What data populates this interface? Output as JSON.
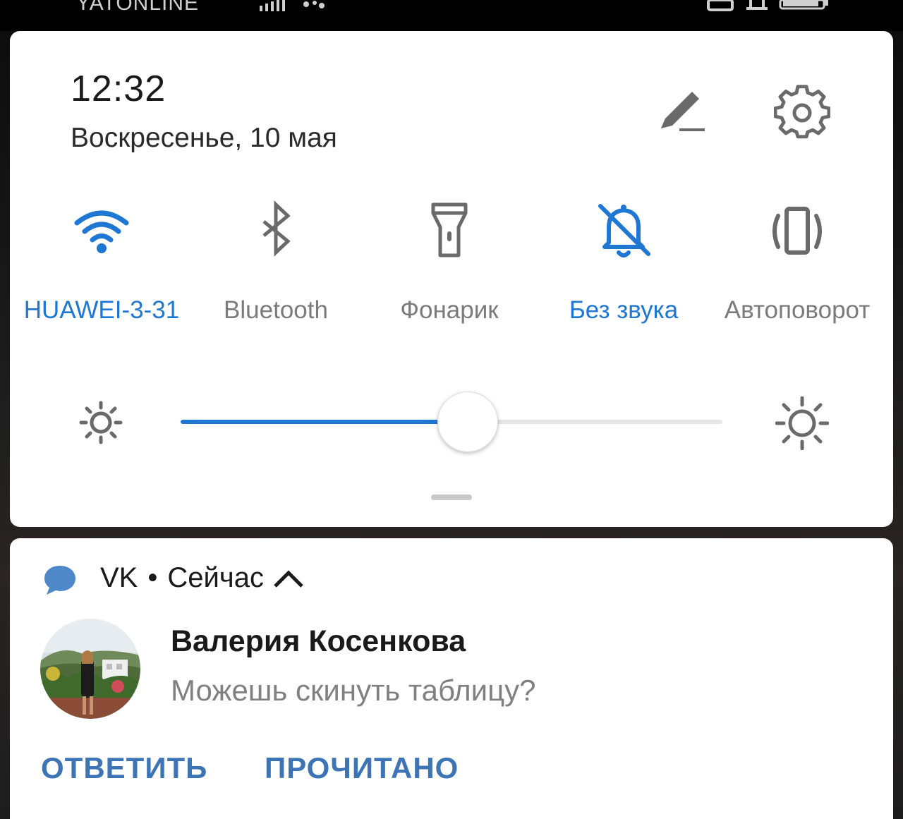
{
  "status_bar": {
    "carrier": "YATONLINE",
    "icons": [
      "signal-icon",
      "data-activity-icon",
      "nfc-icon",
      "silent-bell-icon",
      "battery-icon"
    ]
  },
  "quick_settings": {
    "time": "12:32",
    "date": "Воскресенье, 10 мая",
    "tiles": [
      {
        "label": "HUAWEI-3-31",
        "icon": "wifi-icon",
        "active": true
      },
      {
        "label": "Bluetooth",
        "icon": "bluetooth-icon",
        "active": false
      },
      {
        "label": "Фонарик",
        "icon": "flashlight-icon",
        "active": false
      },
      {
        "label": "Без звука",
        "icon": "bell-off-icon",
        "active": true
      },
      {
        "label": "Автоповорот",
        "icon": "auto-rotate-icon",
        "active": false
      }
    ],
    "brightness_level": 0.53,
    "accent_color": "#1f77d4"
  },
  "notification": {
    "app": "VK",
    "separator": "•",
    "time": "Сейчас",
    "sender": "Валерия Косенкова",
    "message": "Можешь скинуть таблицу?",
    "actions": {
      "reply": "ОТВЕТИТЬ",
      "mark_read": "ПРОЧИТАНО"
    },
    "action_color": "#3d74b6"
  }
}
